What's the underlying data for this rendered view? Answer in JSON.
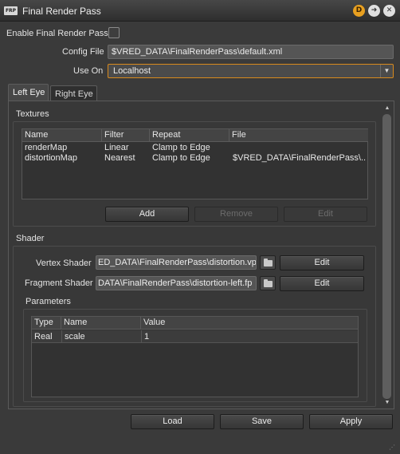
{
  "window": {
    "app_icon": "FRP",
    "title": "Final Render Pass",
    "buttons": [
      "d-badge-icon",
      "arrow-right-icon",
      "close-icon"
    ]
  },
  "form": {
    "enable_label": "Enable Final Render Pass",
    "enable_checked": false,
    "config_label": "Config File",
    "config_value": "$VRED_DATA\\FinalRenderPass\\default.xml",
    "use_on_label": "Use On",
    "use_on_value": "Localhost"
  },
  "tabs": [
    "Left Eye",
    "Right Eye"
  ],
  "active_tab": "Left Eye",
  "textures": {
    "title": "Textures",
    "columns": [
      "Name",
      "Filter",
      "Repeat",
      "File"
    ],
    "rows": [
      [
        "renderMap",
        "Linear",
        "Clamp to Edge",
        ""
      ],
      [
        "distortionMap",
        "Nearest",
        "Clamp to Edge",
        "$VRED_DATA\\FinalRenderPass\\..."
      ]
    ],
    "add_label": "Add",
    "remove_label": "Remove",
    "edit_label": "Edit"
  },
  "shader": {
    "title": "Shader",
    "vertex_label": "Vertex Shader",
    "vertex_value": "ED_DATA\\FinalRenderPass\\distortion.vp",
    "fragment_label": "Fragment Shader",
    "fragment_value": "DATA\\FinalRenderPass\\distortion-left.fp",
    "edit_label": "Edit"
  },
  "parameters": {
    "title": "Parameters",
    "columns": [
      "Type",
      "Name",
      "Value"
    ],
    "rows": [
      [
        "Real",
        "scale",
        "1"
      ]
    ]
  },
  "footer": {
    "load_label": "Load",
    "save_label": "Save",
    "apply_label": "Apply"
  },
  "colors": {
    "accent": "#d98a1c",
    "background": "#3a3a3a"
  }
}
